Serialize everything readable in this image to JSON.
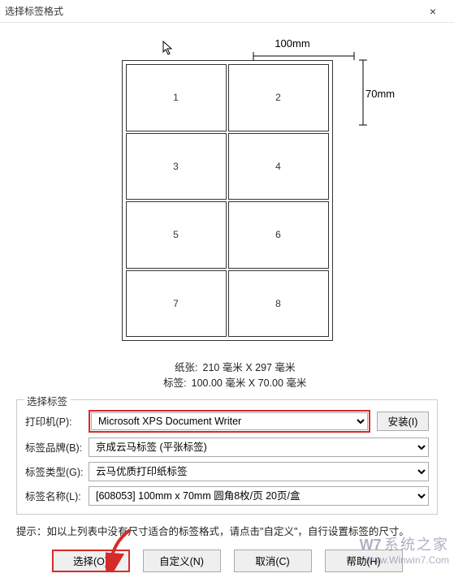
{
  "window": {
    "title": "选择标签格式",
    "close": "×"
  },
  "preview": {
    "dim_top": "100mm",
    "dim_right": "70mm",
    "cells": [
      "1",
      "2",
      "3",
      "4",
      "5",
      "6",
      "7",
      "8"
    ]
  },
  "info": {
    "paper_label": "纸张:",
    "paper_value": "210 毫米 X 297 毫米",
    "label_label": "标签:",
    "label_value": "100.00 毫米 X 70.00 毫米"
  },
  "group": {
    "title": "选择标签",
    "printer_label": "打印机(P):",
    "printer_value": "Microsoft XPS Document Writer",
    "install_btn": "安装(I)",
    "brand_label": "标签品牌(B):",
    "brand_value": "京成云马标签 (平张标签)",
    "type_label": "标签类型(G):",
    "type_value": "云马优质打印纸标签",
    "name_label": "标签名称(L):",
    "name_value": "[608053] 100mm x 70mm 圆角8枚/页 20页/盒"
  },
  "hint": "提示：如以上列表中没有尺寸适合的标签格式，请点击\"自定义\"，自行设置标签的尺寸。",
  "buttons": {
    "select": "选择(O)",
    "custom": "自定义(N)",
    "cancel": "取消(C)",
    "help": "帮助(H)"
  },
  "watermark": {
    "logo": "W7",
    "cn": "系统之家",
    "url": "Www.Winwin7.Com"
  }
}
